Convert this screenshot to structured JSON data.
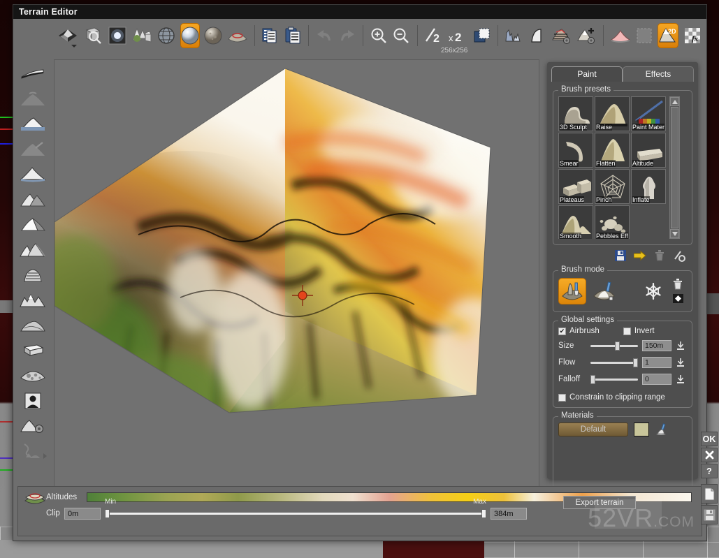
{
  "window": {
    "title": "Terrain Editor"
  },
  "toolbar": {
    "size_label": "256x256",
    "buttons": [
      {
        "name": "terrain-tool",
        "icon": "terrain-diamond-icon",
        "state": "normal"
      },
      {
        "name": "zoom-box-tool",
        "icon": "cube-magnifier-icon",
        "state": "normal"
      },
      {
        "name": "light-tool",
        "icon": "glow-square-icon",
        "state": "normal"
      },
      {
        "name": "vegetation-tool",
        "icon": "trees-cube-icon",
        "state": "normal"
      },
      {
        "name": "globe-tool",
        "icon": "wire-globe-icon",
        "state": "normal"
      },
      {
        "name": "sphere-tool",
        "icon": "shiny-sphere-icon",
        "state": "active"
      },
      {
        "name": "rough-sphere-tool",
        "icon": "rock-sphere-icon",
        "state": "normal"
      },
      {
        "name": "terrain-select-tool",
        "icon": "terrain-oval-icon",
        "state": "normal"
      },
      {
        "name": "copy-button",
        "icon": "copy-icon",
        "state": "normal"
      },
      {
        "name": "paste-button",
        "icon": "paste-icon",
        "state": "normal"
      },
      {
        "name": "undo-button",
        "icon": "undo-arrow-icon",
        "state": "disabled"
      },
      {
        "name": "redo-button",
        "icon": "redo-arrow-icon",
        "state": "disabled"
      },
      {
        "name": "zoom-in-button",
        "icon": "magnifier-plus-icon",
        "state": "normal"
      },
      {
        "name": "zoom-out-button",
        "icon": "magnifier-minus-icon",
        "state": "normal"
      },
      {
        "name": "halve-resolution-button",
        "icon": "divide-two-icon",
        "state": "normal"
      },
      {
        "name": "double-resolution-button",
        "icon": "times-two-icon",
        "state": "normal"
      },
      {
        "name": "canvas-size-button",
        "icon": "overlapping-squares-icon",
        "state": "normal"
      },
      {
        "name": "histogram-button",
        "icon": "histogram-icon",
        "state": "normal"
      },
      {
        "name": "curve-button",
        "icon": "curve-ramp-icon",
        "state": "normal"
      },
      {
        "name": "terrain-settings-button",
        "icon": "terrain-gear-icon",
        "state": "normal"
      },
      {
        "name": "add-terrain-button",
        "icon": "terrain-plus-gear-icon",
        "state": "normal"
      },
      {
        "name": "terrain-shape-button",
        "icon": "pink-terrain-icon",
        "state": "normal"
      },
      {
        "name": "select-all-button",
        "icon": "marquee-select-icon",
        "state": "disabled"
      },
      {
        "name": "view-2d-button",
        "icon": "terrain-2d-icon",
        "state": "active"
      },
      {
        "name": "effects-fx-button",
        "icon": "checker-fx-icon",
        "state": "normal"
      }
    ]
  },
  "left_rail": {
    "items": [
      {
        "name": "rail-flat-terrain",
        "icon": "flat-plane-icon",
        "dim": false,
        "caret": false
      },
      {
        "name": "rail-smooth-peak",
        "icon": "smooth-peak-icon",
        "dim": true,
        "caret": false
      },
      {
        "name": "rail-water-level",
        "icon": "peak-water-icon",
        "dim": false,
        "caret": false
      },
      {
        "name": "rail-paint-peak",
        "icon": "peak-brush-icon",
        "dim": true,
        "caret": false
      },
      {
        "name": "rail-sharp-peak",
        "icon": "sharp-peak-water-icon",
        "dim": false,
        "caret": false
      },
      {
        "name": "rail-twin-mountain",
        "icon": "twin-mountain-icon",
        "dim": false,
        "caret": false
      },
      {
        "name": "rail-ridge",
        "icon": "ridge-icon",
        "dim": false,
        "caret": false
      },
      {
        "name": "rail-rocky-peaks",
        "icon": "rocky-peaks-icon",
        "dim": false,
        "caret": false
      },
      {
        "name": "rail-terraces",
        "icon": "terraced-hill-icon",
        "dim": false,
        "caret": false
      },
      {
        "name": "rail-jagged-range",
        "icon": "jagged-range-icon",
        "dim": false,
        "caret": false
      },
      {
        "name": "rail-eroded-hills",
        "icon": "eroded-hills-icon",
        "dim": false,
        "caret": false
      },
      {
        "name": "rail-plateau-block",
        "icon": "plateau-block-icon",
        "dim": false,
        "caret": false
      },
      {
        "name": "rail-crater-field",
        "icon": "crater-field-icon",
        "dim": false,
        "caret": false
      },
      {
        "name": "rail-heightmap-image",
        "icon": "portrait-image-icon",
        "dim": false,
        "caret": false
      },
      {
        "name": "rail-mountain-gear",
        "icon": "mountain-gear-icon",
        "dim": false,
        "caret": false
      },
      {
        "name": "rail-erosion-flow",
        "icon": "erosion-flow-icon",
        "dim": true,
        "caret": true
      }
    ]
  },
  "panel": {
    "tabs": [
      {
        "label": "Paint",
        "name": "tab-paint",
        "active": true
      },
      {
        "label": "Effects",
        "name": "tab-effects",
        "active": false
      }
    ],
    "brush_presets": {
      "title": "Brush presets",
      "items": [
        {
          "label": "3D Sculpt",
          "icon": "sculpt-shape-icon"
        },
        {
          "label": "Raise",
          "icon": "raise-dome-icon"
        },
        {
          "label": "Paint Mater",
          "icon": "paint-brush-rainbow-icon"
        },
        {
          "label": "Smear",
          "icon": "smear-curve-icon"
        },
        {
          "label": "Flatten",
          "icon": "flatten-peak-icon"
        },
        {
          "label": "Altitude",
          "icon": "altitude-slab-icon"
        },
        {
          "label": "Plateaus",
          "icon": "plateaus-steps-icon"
        },
        {
          "label": "Pinch",
          "icon": "pinch-web-icon"
        },
        {
          "label": "Inflate",
          "icon": "inflate-knob-icon"
        },
        {
          "label": "Smooth",
          "icon": "smooth-hill-icon"
        },
        {
          "label": "Pebbles Eff",
          "icon": "pebbles-icon"
        }
      ],
      "toolbar_icons": [
        {
          "name": "save-preset-button",
          "icon": "floppy-disk-icon",
          "dim": false
        },
        {
          "name": "apply-preset-button",
          "icon": "yellow-arrow-icon",
          "dim": false
        },
        {
          "name": "delete-preset-button",
          "icon": "trash-icon",
          "dim": true
        },
        {
          "name": "preset-settings-button",
          "icon": "brush-gear-icon",
          "dim": false
        }
      ]
    },
    "brush_mode": {
      "title": "Brush mode",
      "buttons": [
        {
          "name": "sculpt-mode-button",
          "icon": "chisel-shovel-icon",
          "active": true
        },
        {
          "name": "paint-mode-button",
          "icon": "brush-terrain-icon",
          "active": false
        },
        {
          "name": "freeze-mode-button",
          "icon": "snowflake-icon",
          "active": false
        }
      ],
      "side_buttons": [
        {
          "name": "clear-mask-button",
          "icon": "trash-icon"
        },
        {
          "name": "fill-mask-button",
          "icon": "filled-square-icon"
        }
      ]
    },
    "global_settings": {
      "title": "Global settings",
      "airbrush": {
        "label": "Airbrush",
        "checked": true
      },
      "invert": {
        "label": "Invert",
        "checked": false
      },
      "sliders": [
        {
          "label": "Size",
          "value": "150m",
          "pos": 52
        },
        {
          "label": "Flow",
          "value": "1",
          "pos": 100
        },
        {
          "label": "Falloff",
          "value": "0",
          "pos": 1
        }
      ],
      "constrain": {
        "label": "Constrain to clipping range",
        "checked": false
      }
    },
    "materials": {
      "title": "Materials",
      "default_label": "Default",
      "swatch_color": "#c8c59a",
      "toolbar_icons": [
        {
          "name": "save-material-button",
          "icon": "floppy-disk-icon",
          "dim": false
        },
        {
          "name": "export-material-button",
          "icon": "checker-arrow-icon",
          "dim": false
        },
        {
          "name": "delete-material-button",
          "icon": "trash-icon",
          "dim": true
        }
      ]
    }
  },
  "bottom": {
    "altitudes_label": "Altitudes",
    "altitudes_icon": "altitude-layers-icon",
    "min_label": "Min",
    "max_label": "Max",
    "clip_label": "Clip",
    "clip_value": "0m",
    "max_value": "384m",
    "export_label": "Export terrain",
    "gradient_stops": [
      "#4f8039",
      "#6f9440",
      "#9aa352",
      "#b0a957",
      "#8f9a4a",
      "#b8b87e",
      "#e2d9bc",
      "#efe0cf",
      "#e3a392",
      "#f0c23a",
      "#f5cf16",
      "#eec13a",
      "#f6f0de",
      "#eda04b",
      "#f3e6d2",
      "#fbf7ee"
    ]
  },
  "edge_buttons": [
    {
      "label": "OK",
      "name": "ok-button",
      "icon": null
    },
    {
      "label": "✖",
      "name": "close-button",
      "icon": "x-icon"
    },
    {
      "label": "?",
      "name": "help-button",
      "icon": "question-icon"
    },
    {
      "label": "",
      "name": "new-file-button",
      "icon": "page-icon"
    },
    {
      "label": "",
      "name": "save-file-button",
      "icon": "floppy-disk-icon"
    }
  ],
  "watermark": {
    "text": "52VR",
    "domain": ".COM"
  },
  "viewport": {
    "name": "terrain-3d-viewport",
    "cursor": "brush-crosshair-cursor"
  }
}
